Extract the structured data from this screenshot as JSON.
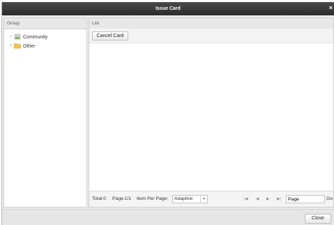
{
  "window": {
    "title": "Issue Card",
    "close_glyph": "×"
  },
  "group_panel": {
    "header": "Group",
    "tree": [
      {
        "expander": "+",
        "icon": "community-icon",
        "label": "Community"
      },
      {
        "expander": "+",
        "icon": "folder-icon",
        "label": "Other"
      }
    ]
  },
  "list_panel": {
    "header": "List",
    "toolbar": {
      "cancel_card_label": "Cancel Card"
    },
    "pager": {
      "total_text": "Total:0",
      "page_text": "Page:1/1",
      "items_per_page_label": "Item Per Page:",
      "items_per_page_value": "Adaptive",
      "first_icon": "first-page-icon",
      "prev_icon": "prev-page-icon",
      "next_icon": "next-page-icon",
      "last_icon": "last-page-icon",
      "page_input_value": "Page",
      "go_label": "Go"
    }
  },
  "footer": {
    "close_label": "Close"
  },
  "colors": {
    "titlebar": "#2b2b2b",
    "background": "#ececec",
    "folder": "#f2c14e",
    "community": "#8fae5a"
  }
}
